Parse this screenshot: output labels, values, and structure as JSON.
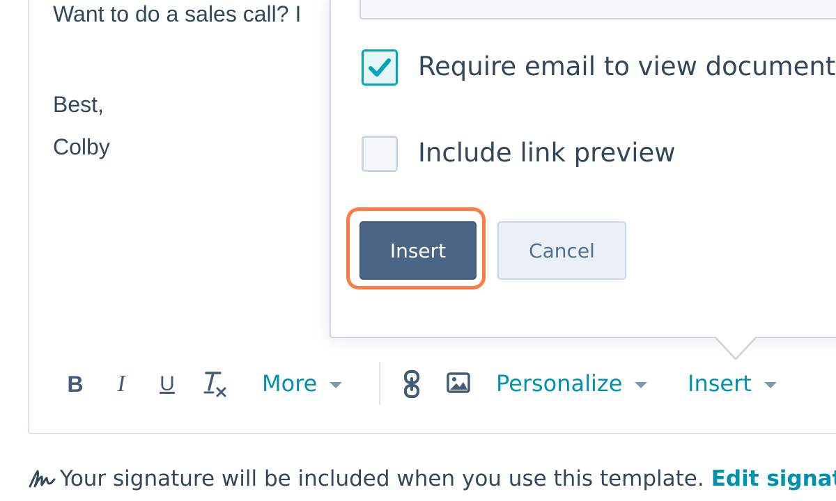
{
  "editor": {
    "body_lines": [
      "Want to do a sales call? I",
      "Best,",
      "Colby"
    ]
  },
  "popover": {
    "options": [
      {
        "label": "Require email to view document",
        "checked": true
      },
      {
        "label": "Include link preview",
        "checked": false
      }
    ],
    "insert_label": "Insert",
    "cancel_label": "Cancel"
  },
  "toolbar": {
    "bold_label": "B",
    "italic_label": "I",
    "underline_label": "U",
    "more_label": "More",
    "personalize_label": "Personalize",
    "insert_label": "Insert",
    "icons": [
      "bold-icon",
      "italic-icon",
      "underline-icon",
      "clear-format-icon",
      "link-icon",
      "image-icon"
    ]
  },
  "footer": {
    "signature_text": "Your signature will be included when you use this template.",
    "edit_link": "Edit signature"
  },
  "colors": {
    "accent": "#0091ae",
    "primary_button": "#4b6585",
    "focus_ring": "#ff7a45",
    "checkbox_checked": "#00a4bd",
    "text": "#33475b"
  }
}
